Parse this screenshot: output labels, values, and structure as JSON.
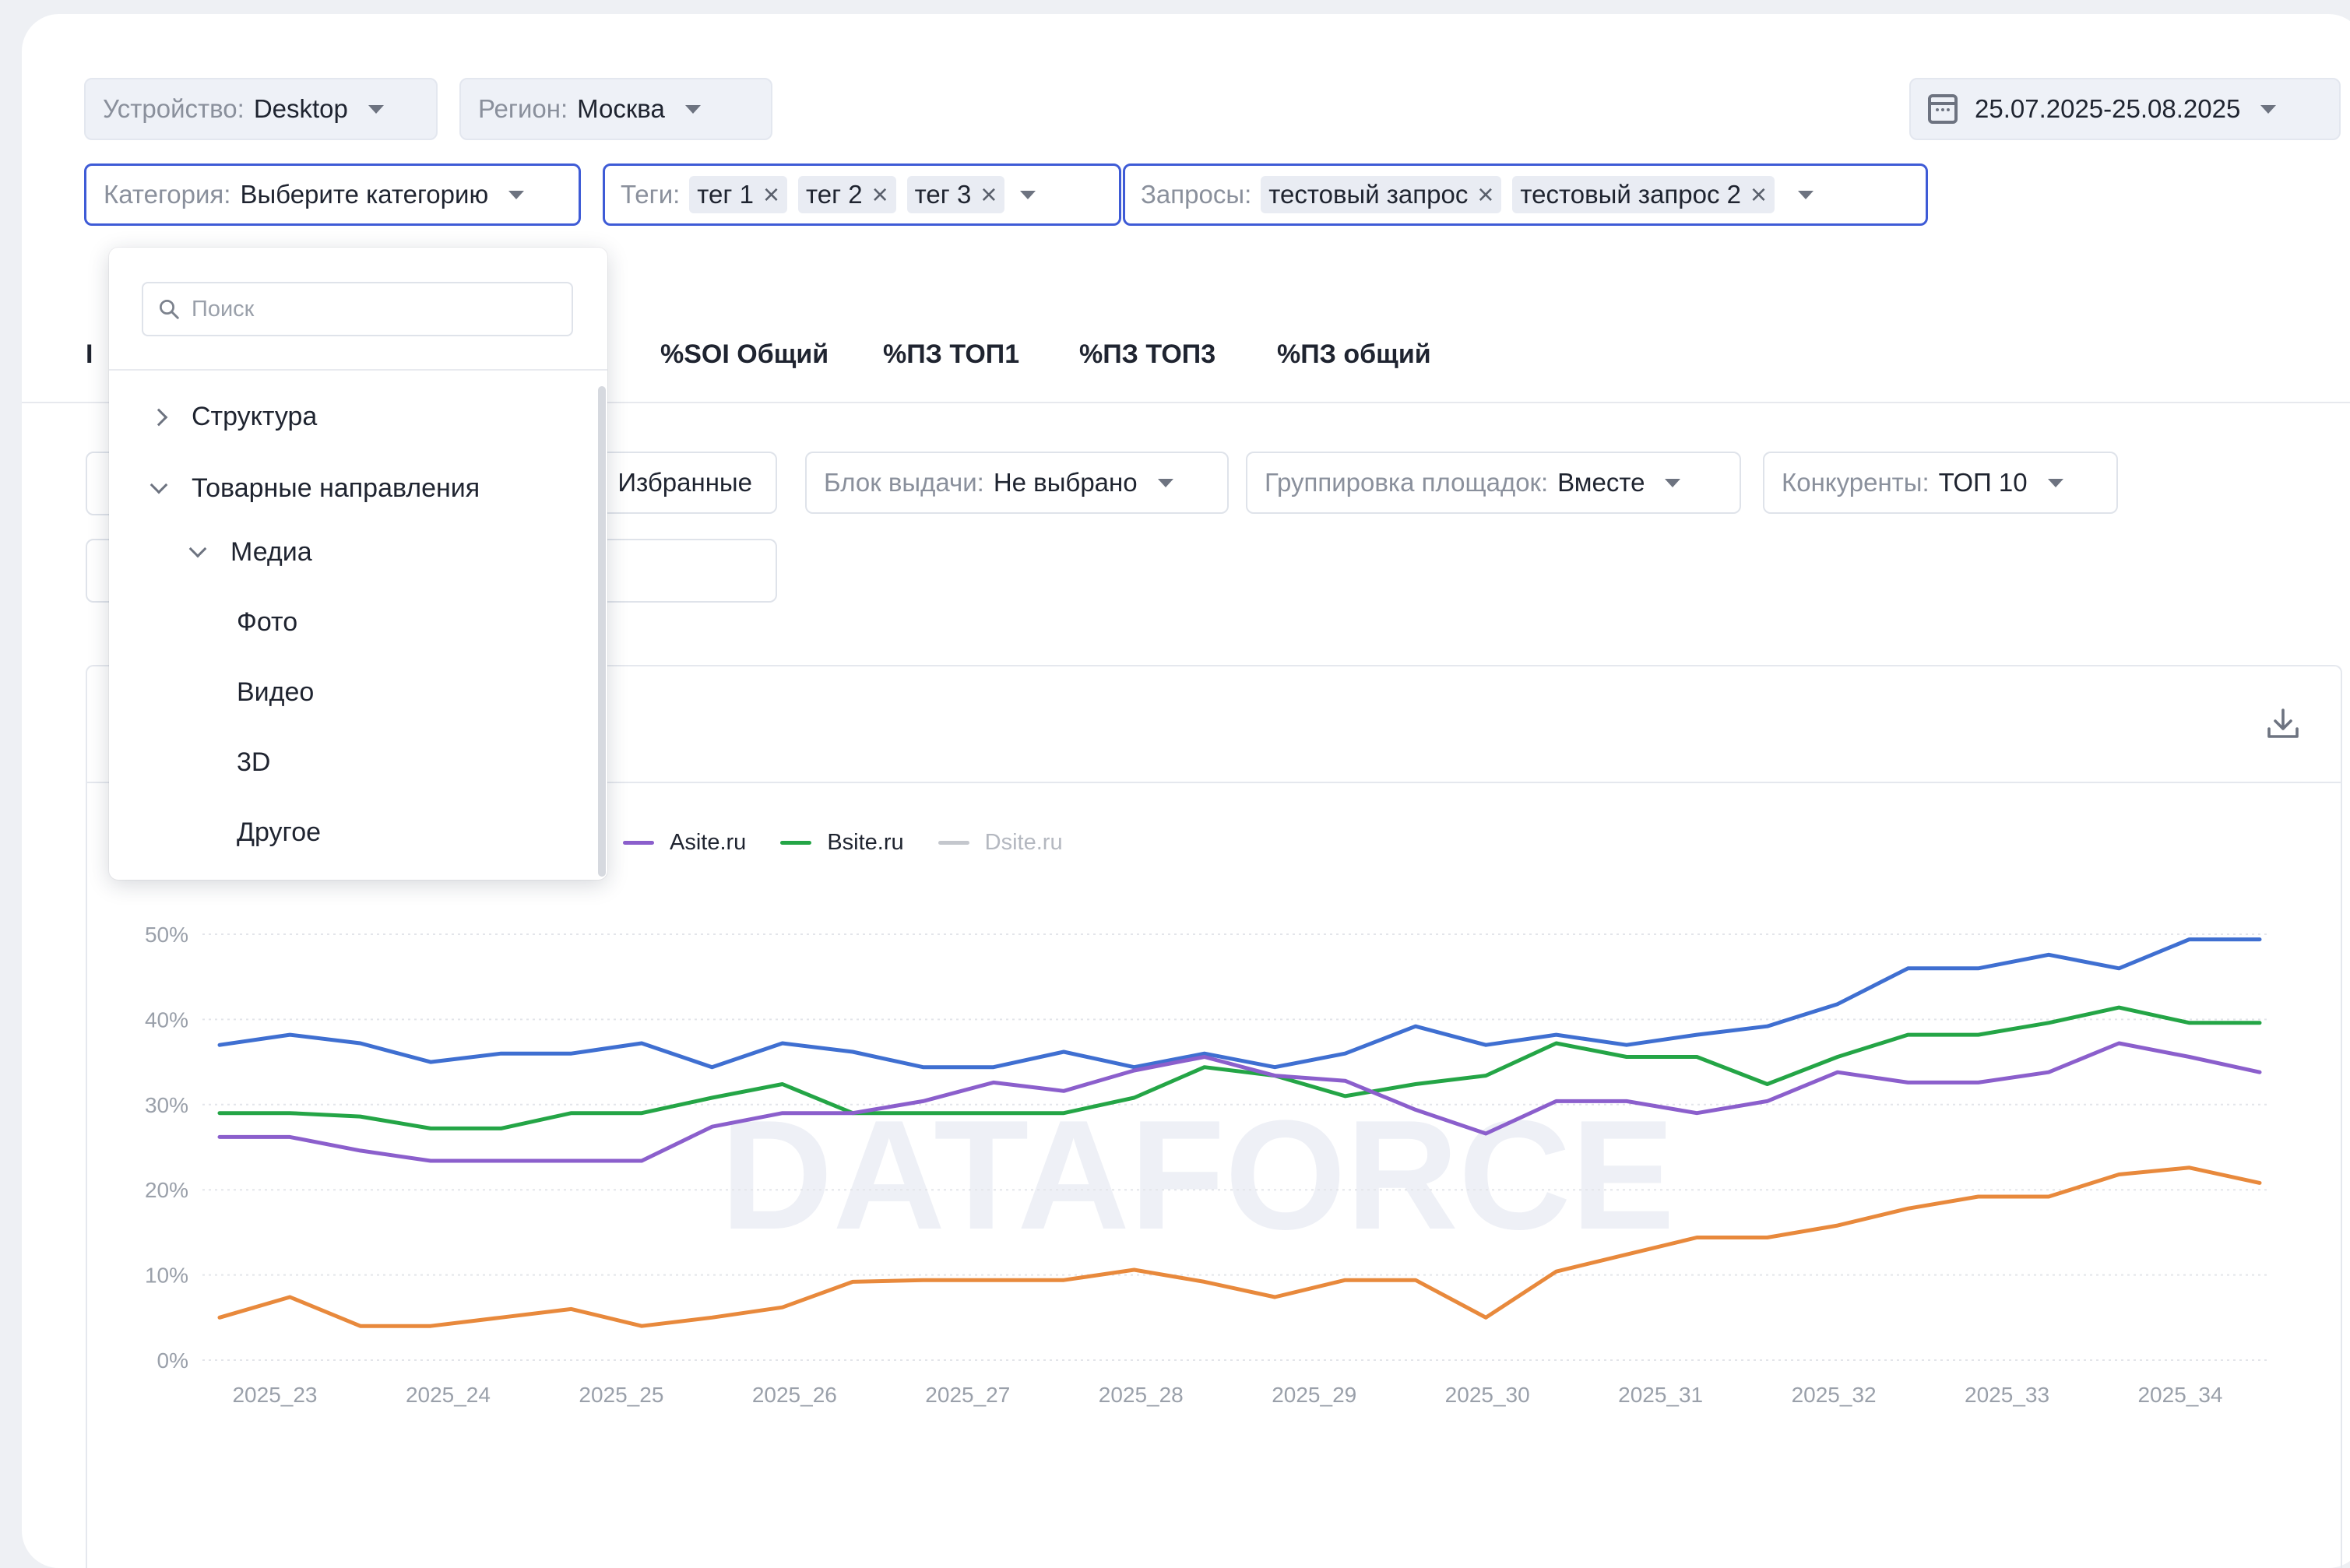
{
  "filters": {
    "device": {
      "label": "Устройство:",
      "value": "Desktop"
    },
    "region": {
      "label": "Регион:",
      "value": "Москва"
    },
    "date_range": "25.07.2025-25.08.2025",
    "category": {
      "label": "Категория:",
      "value": "Выберите категорию"
    },
    "tags": {
      "label": "Теги:",
      "items": [
        "тег 1",
        "тег 2",
        "тег 3"
      ]
    },
    "queries": {
      "label": "Запросы:",
      "items": [
        "тестовый запрос",
        "тестовый запрос 2"
      ]
    }
  },
  "tabs": {
    "partial": "3",
    "items": [
      "%SOI Общий",
      "%ПЗ ТОП1",
      "%ПЗ ТОП3",
      "%ПЗ общий"
    ]
  },
  "subfilters": {
    "favorites": "Избранные",
    "block": {
      "label": "Блок выдачи:",
      "value": "Не выбрано"
    },
    "grouping": {
      "label": "Группировка площадок:",
      "value": "Вместе"
    },
    "competitors": {
      "label": "Конкуренты:",
      "value": "ТОП 10"
    }
  },
  "dropdown": {
    "search_placeholder": "Поиск",
    "items": [
      {
        "label": "Структура",
        "level": 0,
        "expanded": false
      },
      {
        "label": "Товарные направления",
        "level": 0,
        "expanded": true
      },
      {
        "label": "Медиа",
        "level": 1,
        "expanded": true
      },
      {
        "label": "Фото",
        "level": 2
      },
      {
        "label": "Видео",
        "level": 2
      },
      {
        "label": "3D",
        "level": 2
      },
      {
        "label": "Другое",
        "level": 2
      }
    ]
  },
  "watermark": "DATAFORCE",
  "colors": {
    "accent": "#3e5bd6",
    "blue": "#3f6fd1",
    "orange": "#e8893c",
    "purple": "#8b5fcc",
    "green": "#24a546",
    "gray": "#c4c7cd"
  },
  "chart_data": {
    "type": "line",
    "x": [
      "2025_23",
      "2025_24",
      "2025_25",
      "2025_26",
      "2025_27",
      "2025_28",
      "2025_29",
      "2025_30",
      "2025_31",
      "2025_32",
      "2025_33",
      "2025_34"
    ],
    "x_ticks": [
      "2025_23",
      "2025_24",
      "2025_25",
      "2025_26",
      "2025_27",
      "2025_28",
      "2025_29",
      "2025_30",
      "2025_31",
      "2025_32",
      "2025_33",
      "2025_34"
    ],
    "y_ticks": [
      "0%",
      "10%",
      "20%",
      "30%",
      "40%",
      "50%"
    ],
    "ylim": [
      0,
      50
    ],
    "grid": true,
    "legend": [
      {
        "name": "Asite.ru",
        "color": "#8b5fcc",
        "muted": false
      },
      {
        "name": "Bsite.ru",
        "color": "#24a546",
        "muted": false
      },
      {
        "name": "Dsite.ru",
        "color": "#c4c7cd",
        "muted": true
      }
    ],
    "series": [
      {
        "color": "#3f6fd1",
        "values": [
          37,
          38.2,
          37.2,
          35,
          36,
          36,
          37.2,
          34.4,
          37.2,
          36.2,
          34.4,
          34.4,
          36.2,
          34.4,
          36,
          34.4,
          36,
          39.2,
          37,
          38.2,
          37,
          38.2,
          39.2,
          41.8,
          46,
          46,
          47.6,
          46,
          49.4,
          49.4
        ]
      },
      {
        "color": "#24a546",
        "values": [
          29,
          29,
          28.6,
          27.2,
          27.2,
          29,
          29,
          30.8,
          32.4,
          29,
          29,
          29,
          29,
          30.8,
          34.4,
          33.4,
          31,
          32.4,
          33.4,
          37.2,
          35.6,
          35.6,
          32.4,
          35.6,
          38.2,
          38.2,
          39.6,
          41.4,
          39.6,
          39.6
        ]
      },
      {
        "color": "#8b5fcc",
        "values": [
          26.2,
          26.2,
          24.6,
          23.4,
          23.4,
          23.4,
          23.4,
          27.4,
          29,
          29,
          30.4,
          32.6,
          31.6,
          34,
          35.6,
          33.4,
          32.8,
          29.4,
          26.6,
          30.4,
          30.4,
          29,
          30.4,
          33.8,
          32.6,
          32.6,
          33.8,
          37.2,
          35.6,
          33.8
        ]
      },
      {
        "color": "#e8893c",
        "values": [
          5,
          7.4,
          4,
          4,
          5,
          6,
          4,
          5,
          6.2,
          9.2,
          9.4,
          9.4,
          9.4,
          10.6,
          9.2,
          7.4,
          9.4,
          9.4,
          5,
          10.4,
          12.4,
          14.4,
          14.4,
          15.8,
          17.8,
          19.2,
          19.2,
          21.8,
          22.6,
          20.8
        ]
      }
    ]
  }
}
